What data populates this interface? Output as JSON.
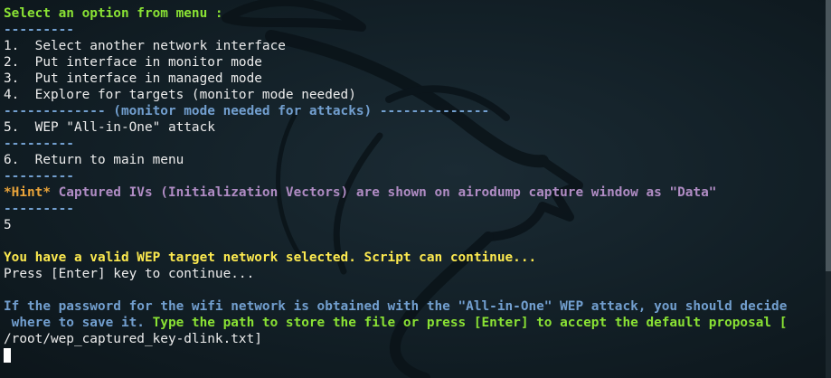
{
  "terminal": {
    "lines": [
      {
        "text": "Select an option from menu :",
        "style": "green"
      },
      {
        "text": "---------",
        "style": "blue"
      },
      {
        "text": "1.  Select another network interface",
        "style": "white"
      },
      {
        "text": "2.  Put interface in monitor mode",
        "style": "white"
      },
      {
        "text": "3.  Put interface in managed mode",
        "style": "white"
      },
      {
        "text": "4.  Explore for targets (monitor mode needed)",
        "style": "white"
      },
      {
        "text": "------------- (monitor mode needed for attacks) --------------",
        "style": "blue"
      },
      {
        "text": "5.  WEP \"All-in-One\" attack",
        "style": "white"
      },
      {
        "text": "---------",
        "style": "blue"
      },
      {
        "text": "6.  Return to main menu",
        "style": "white"
      },
      {
        "text": "---------",
        "style": "blue"
      },
      {
        "segments": [
          {
            "text": "*Hint*",
            "style": "orange"
          },
          {
            "text": " Captured IVs (Initialization Vectors) are shown on airodump capture window as \"Data\"",
            "style": "purple"
          }
        ]
      },
      {
        "text": "---------",
        "style": "blue"
      },
      {
        "text": "5",
        "style": "white"
      },
      {
        "text": "",
        "style": "white"
      },
      {
        "text": "You have a valid WEP target network selected. Script can continue...",
        "style": "yellow"
      },
      {
        "text": "Press [Enter] key to continue...",
        "style": "white"
      },
      {
        "text": "",
        "style": "white"
      },
      {
        "text": "If the password for the wifi network is obtained with the \"All-in-One\" WEP attack, you should decide",
        "style": "blue"
      },
      {
        "segments": [
          {
            "text": " where to save it.",
            "style": "blue"
          },
          {
            "text": " Type the path to store the file or press [Enter] to accept the default proposal [",
            "style": "green"
          }
        ]
      },
      {
        "text": "/root/wep_captured_key-dlink.txt]",
        "style": "white"
      }
    ],
    "colors": {
      "background": "#121f26",
      "green": "#8ae234",
      "blue": "#729fcf",
      "purple": "#b08cc4",
      "yellow": "#fce94f",
      "orange": "#e8a33a",
      "white": "#ececec"
    }
  }
}
